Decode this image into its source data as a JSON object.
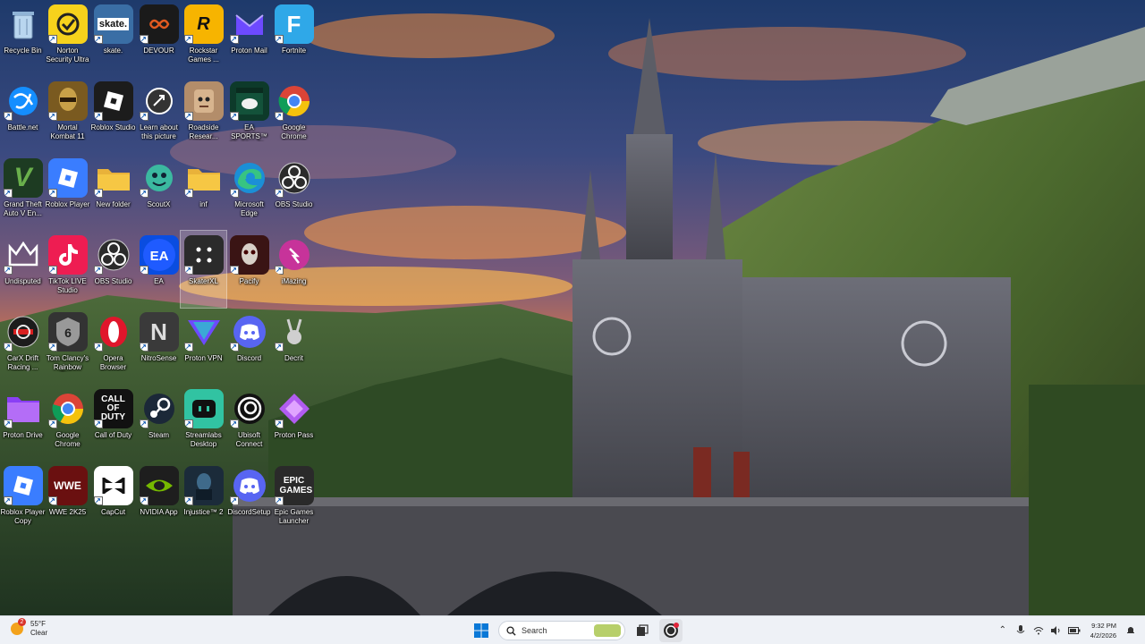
{
  "desktop": {
    "icons": [
      {
        "label": "Recycle Bin",
        "icon": "recycle-bin-icon"
      },
      {
        "label": "Norton Security Ultra",
        "icon": "norton-icon"
      },
      {
        "label": "skate.",
        "icon": "skate-icon"
      },
      {
        "label": "DEVOUR",
        "icon": "devour-icon"
      },
      {
        "label": "Rockstar Games ...",
        "icon": "rockstar-icon"
      },
      {
        "label": "Proton Mail",
        "icon": "proton-mail-icon"
      },
      {
        "label": "Fortnite",
        "icon": "fortnite-icon"
      },
      {
        "label": "Battle.net",
        "icon": "battlenet-icon"
      },
      {
        "label": "Mortal Kombat 11",
        "icon": "mortal-kombat-icon"
      },
      {
        "label": "Roblox Studio",
        "icon": "roblox-studio-icon"
      },
      {
        "label": "Learn about this picture",
        "icon": "learn-picture-icon"
      },
      {
        "label": "Roadside Resear...",
        "icon": "roadside-icon"
      },
      {
        "label": "EA SPORTS™ Madden N...",
        "icon": "madden-icon"
      },
      {
        "label": "Google Chrome",
        "icon": "chrome-icon"
      },
      {
        "label": "Grand Theft Auto V En...",
        "icon": "gta-icon"
      },
      {
        "label": "Roblox Player",
        "icon": "roblox-player-icon"
      },
      {
        "label": "New folder",
        "icon": "folder-icon"
      },
      {
        "label": "ScoutX",
        "icon": "scoutx-icon"
      },
      {
        "label": "inf",
        "icon": "folder-icon"
      },
      {
        "label": "Microsoft Edge",
        "icon": "edge-icon"
      },
      {
        "label": "OBS Studio",
        "icon": "obs-icon"
      },
      {
        "label": "Undisputed",
        "icon": "undisputed-icon"
      },
      {
        "label": "TikTok LIVE Studio",
        "icon": "tiktok-icon"
      },
      {
        "label": "OBS Studio",
        "icon": "obs-icon"
      },
      {
        "label": "EA",
        "icon": "ea-icon"
      },
      {
        "label": "SkaterXL",
        "icon": "skaterxl-icon"
      },
      {
        "label": "Pacify",
        "icon": "pacify-icon"
      },
      {
        "label": "iMazing",
        "icon": "imazing-icon"
      },
      {
        "label": "CarX Drift Racing ...",
        "icon": "carx-icon"
      },
      {
        "label": "Tom Clancy's Rainbow Six...",
        "icon": "rainbow-six-icon"
      },
      {
        "label": "Opera Browser",
        "icon": "opera-icon"
      },
      {
        "label": "NitroSense",
        "icon": "nitrosense-icon"
      },
      {
        "label": "Proton VPN",
        "icon": "proton-vpn-icon"
      },
      {
        "label": "Discord",
        "icon": "discord-icon"
      },
      {
        "label": "Decrit",
        "icon": "decrit-icon"
      },
      {
        "label": "Proton Drive",
        "icon": "proton-drive-icon"
      },
      {
        "label": "Google Chrome",
        "icon": "chrome-icon"
      },
      {
        "label": "Call of Duty",
        "icon": "call-of-duty-icon"
      },
      {
        "label": "Steam",
        "icon": "steam-icon"
      },
      {
        "label": "Streamlabs Desktop",
        "icon": "streamlabs-icon"
      },
      {
        "label": "Ubisoft Connect",
        "icon": "ubisoft-icon"
      },
      {
        "label": "Proton Pass",
        "icon": "proton-pass-icon"
      },
      {
        "label": "Roblox Player Copy",
        "icon": "roblox-player-icon"
      },
      {
        "label": "WWE 2K25",
        "icon": "wwe-icon"
      },
      {
        "label": "CapCut",
        "icon": "capcut-icon"
      },
      {
        "label": "NVIDIA App",
        "icon": "nvidia-icon"
      },
      {
        "label": "Injustice™ 2",
        "icon": "injustice-icon"
      },
      {
        "label": "DiscordSetup",
        "icon": "discord-icon"
      },
      {
        "label": "Epic Games Launcher",
        "icon": "epic-games-icon"
      }
    ],
    "tile_texts": {
      "skate": "skate.",
      "callofduty": "CALL OF DUTY",
      "epic": "EPIC GAMES",
      "ea": "EA",
      "fortnite": "F",
      "nitro": "N",
      "gta": "V",
      "rainbow": "6",
      "wwe": "WWE"
    }
  },
  "taskbar": {
    "weather": {
      "temp": "55°F",
      "condition": "Clear",
      "badge": "2"
    },
    "search_placeholder": "Search",
    "clock": {
      "time": "9:32 PM",
      "date": "4/2/2026"
    }
  },
  "colors": {
    "accent": "#0067c0",
    "taskbar_bg": "#eef1f6",
    "folder": "#f6c744"
  }
}
